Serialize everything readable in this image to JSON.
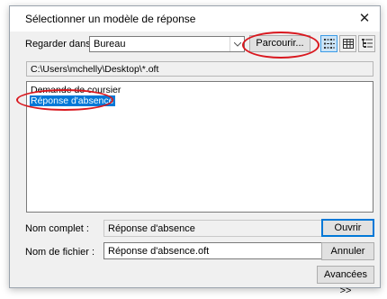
{
  "dialog": {
    "title": "Sélectionner un modèle de réponse",
    "close_glyph": "✕"
  },
  "lookin": {
    "label": "Regarder dans :",
    "value": "Bureau",
    "browse_label": "Parcourir..."
  },
  "view_buttons": [
    {
      "icon": "list-view-icon",
      "active": true
    },
    {
      "icon": "details-view-icon",
      "active": false
    },
    {
      "icon": "tree-view-icon",
      "active": false
    }
  ],
  "path": "C:\\Users\\mchelly\\Desktop\\*.oft",
  "files": [
    {
      "name": "Demande de coursier",
      "selected": false
    },
    {
      "name": "Réponse d'absence",
      "selected": true
    }
  ],
  "fullname": {
    "label": "Nom complet :",
    "value": "Réponse d'absence"
  },
  "filename": {
    "label": "Nom de fichier :",
    "value": "Réponse d'absence.oft"
  },
  "buttons": {
    "open": "Ouvrir",
    "cancel": "Annuler",
    "advanced": "Avancées >>"
  },
  "colors": {
    "selection": "#0078d7",
    "annotation": "#d9181f"
  }
}
